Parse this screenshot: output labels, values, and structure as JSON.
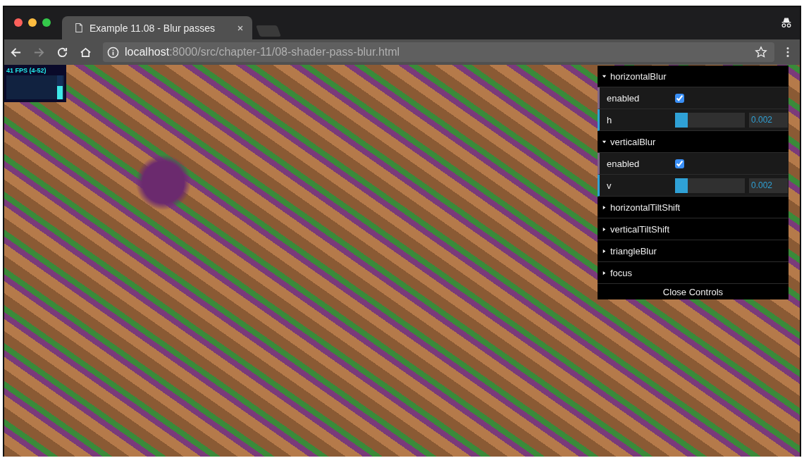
{
  "tab": {
    "title": "Example 11.08 - Blur passes",
    "selected": true
  },
  "address_bar": {
    "host": "localhost",
    "path": ":8000/src/chapter-11/08-shader-pass-blur.html"
  },
  "stats": {
    "text": "41 FPS (4-52)",
    "level": 0.55
  },
  "controls": {
    "folders": [
      {
        "name": "horizontalBlur",
        "expanded": true,
        "items": [
          {
            "kind": "checkbox",
            "label": "enabled",
            "checked": true
          },
          {
            "kind": "slider",
            "label": "h",
            "level": 0.18,
            "value": "0.002"
          }
        ]
      },
      {
        "name": "verticalBlur",
        "expanded": true,
        "items": [
          {
            "kind": "checkbox",
            "label": "enabled",
            "checked": true
          },
          {
            "kind": "slider",
            "label": "v",
            "level": 0.18,
            "value": "0.002"
          }
        ]
      },
      {
        "name": "horizontalTiltShift",
        "expanded": false
      },
      {
        "name": "verticalTiltShift",
        "expanded": false
      },
      {
        "name": "triangleBlur",
        "expanded": false
      },
      {
        "name": "focus",
        "expanded": false
      }
    ],
    "close_button": "Close Controls"
  }
}
